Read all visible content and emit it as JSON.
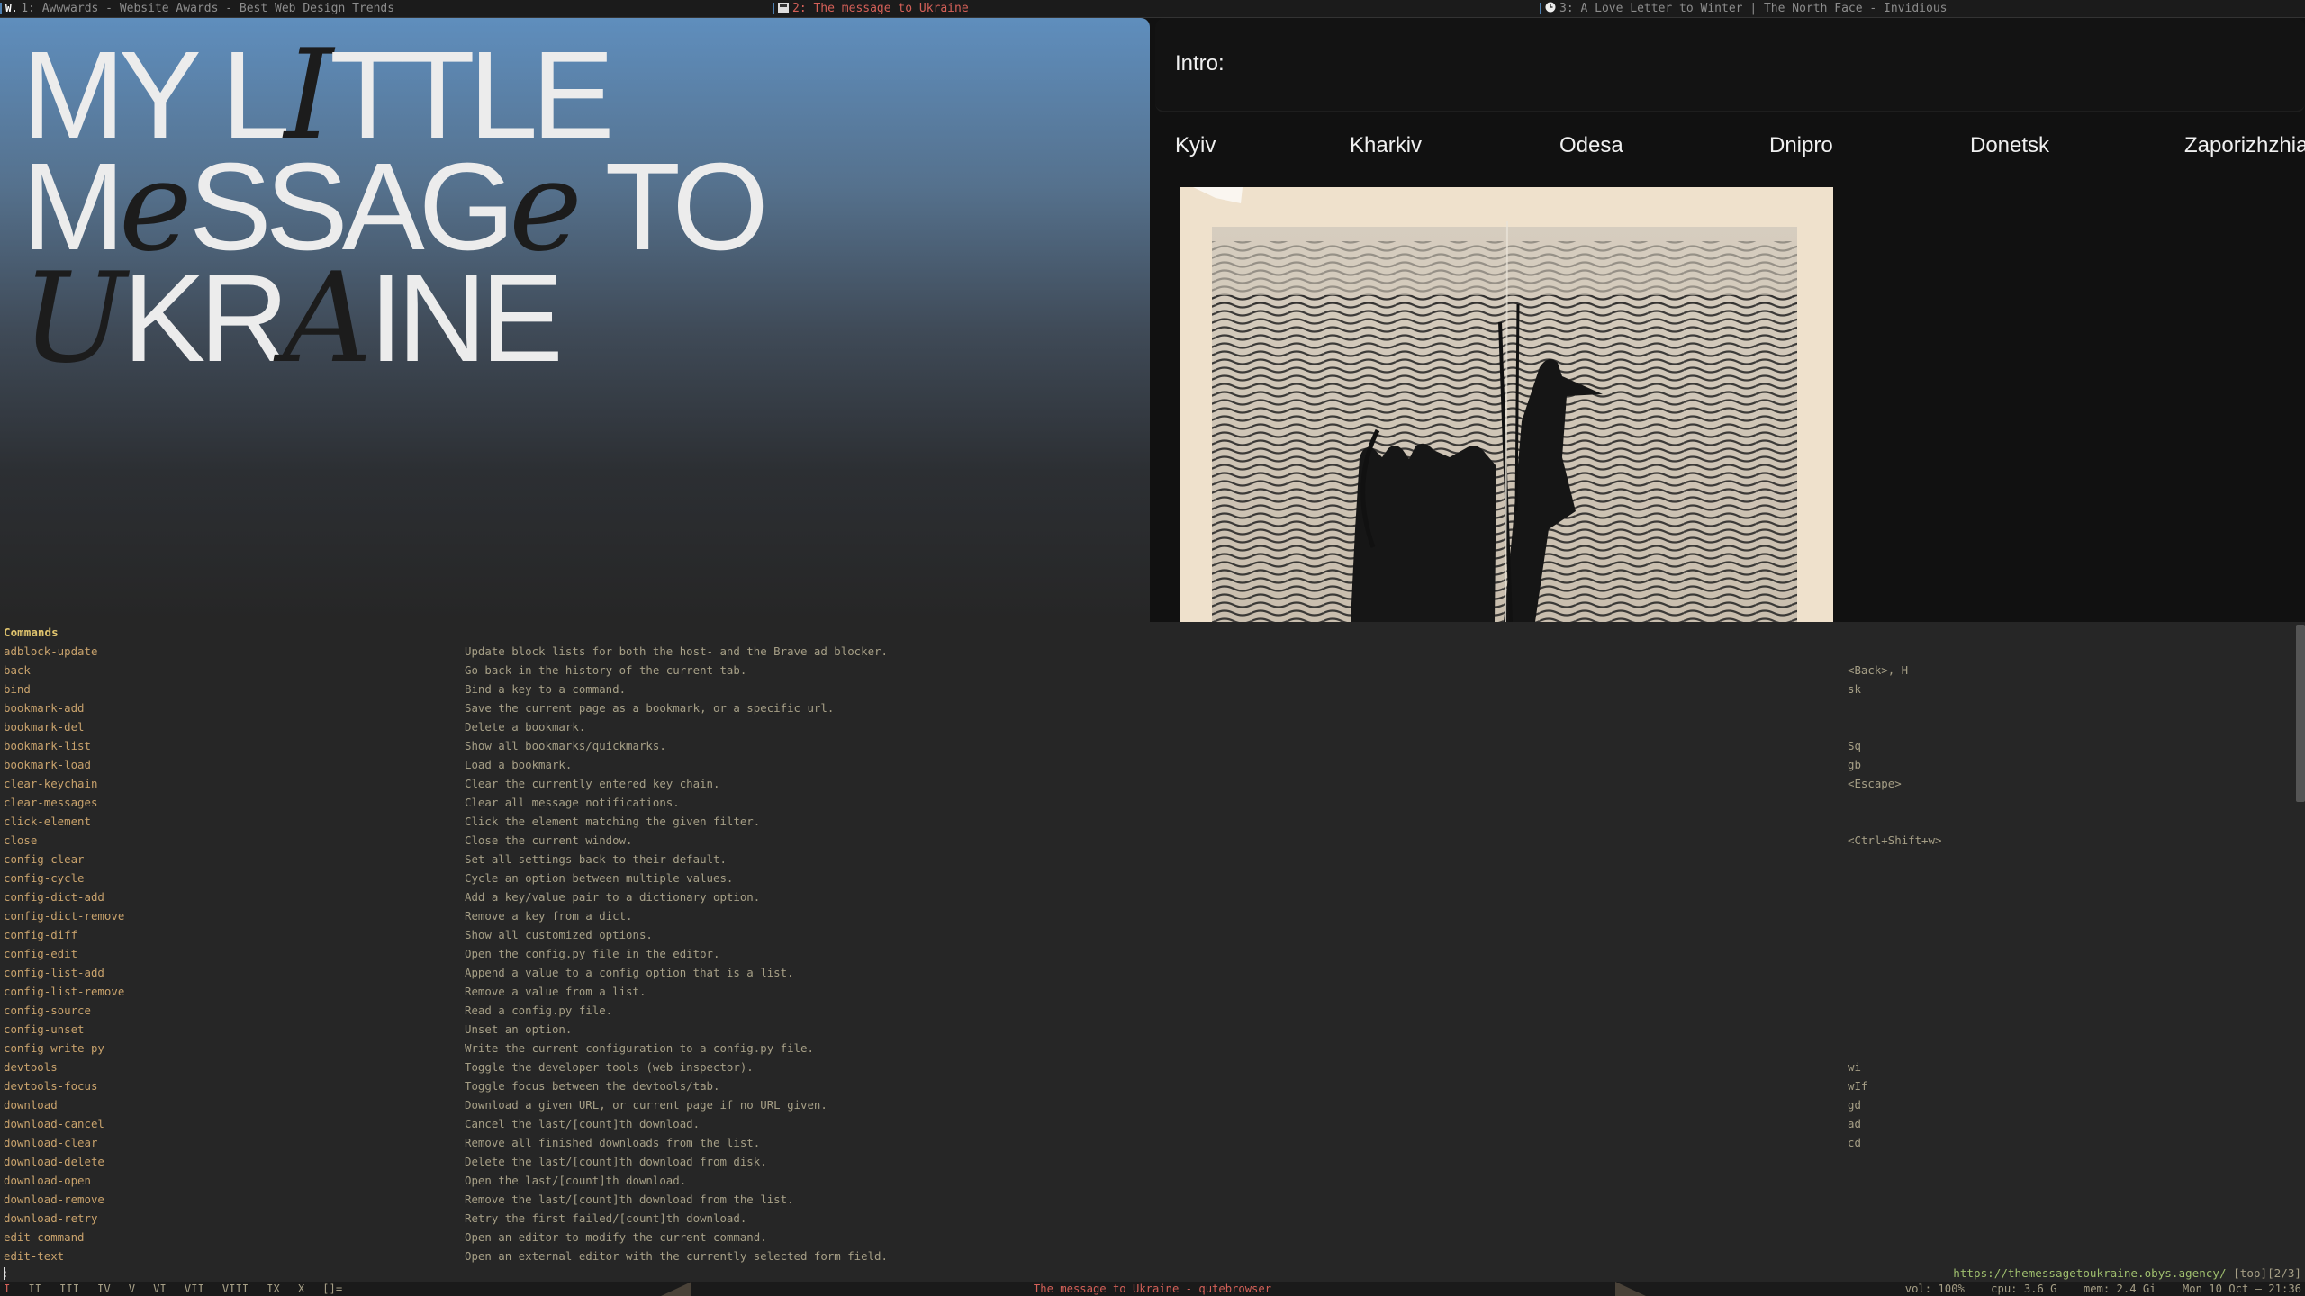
{
  "tabs": [
    {
      "label": "1: Awwwards - Website Awards - Best Web Design Trends",
      "favicon": "W.",
      "active": false
    },
    {
      "label": "2: The message to Ukraine",
      "favicon": "flag-icon",
      "active": true
    },
    {
      "label": "3: A Love Letter to Winter | The North Face - Invidious",
      "favicon": "clock-icon",
      "active": false
    }
  ],
  "hero": {
    "line1_a": "MY L",
    "line1_b": "I",
    "line1_c": "TTLE",
    "line2_a": "M",
    "line2_b": "e",
    "line2_c": "SSAG",
    "line2_d": "e",
    "line2_e": " TO",
    "line3_a": "U",
    "line3_b": "KR",
    "line3_c": "A",
    "line3_d": "INE"
  },
  "intro": {
    "label": "Intro:"
  },
  "cities": [
    "Kyiv",
    "Kharkiv",
    "Odesa",
    "Dnipro",
    "Donetsk",
    "Zaporizhzhia"
  ],
  "completion": {
    "header": "Commands",
    "commands": [
      {
        "name": "adblock-update",
        "desc": "Update block lists for both the host- and the Brave ad blocker.",
        "keys": ""
      },
      {
        "name": "back",
        "desc": "Go back in the history of the current tab.",
        "keys": "<Back>, H"
      },
      {
        "name": "bind",
        "desc": "Bind a key to a command.",
        "keys": "sk"
      },
      {
        "name": "bookmark-add",
        "desc": "Save the current page as a bookmark, or a specific url.",
        "keys": ""
      },
      {
        "name": "bookmark-del",
        "desc": "Delete a bookmark.",
        "keys": ""
      },
      {
        "name": "bookmark-list",
        "desc": "Show all bookmarks/quickmarks.",
        "keys": "Sq"
      },
      {
        "name": "bookmark-load",
        "desc": "Load a bookmark.",
        "keys": "gb"
      },
      {
        "name": "clear-keychain",
        "desc": "Clear the currently entered key chain.",
        "keys": "<Escape>"
      },
      {
        "name": "clear-messages",
        "desc": "Clear all message notifications.",
        "keys": ""
      },
      {
        "name": "click-element",
        "desc": "Click the element matching the given filter.",
        "keys": ""
      },
      {
        "name": "close",
        "desc": "Close the current window.",
        "keys": "<Ctrl+Shift+w>"
      },
      {
        "name": "config-clear",
        "desc": "Set all settings back to their default.",
        "keys": ""
      },
      {
        "name": "config-cycle",
        "desc": "Cycle an option between multiple values.",
        "keys": ""
      },
      {
        "name": "config-dict-add",
        "desc": "Add a key/value pair to a dictionary option.",
        "keys": ""
      },
      {
        "name": "config-dict-remove",
        "desc": "Remove a key from a dict.",
        "keys": ""
      },
      {
        "name": "config-diff",
        "desc": "Show all customized options.",
        "keys": ""
      },
      {
        "name": "config-edit",
        "desc": "Open the config.py file in the editor.",
        "keys": ""
      },
      {
        "name": "config-list-add",
        "desc": "Append a value to a config option that is a list.",
        "keys": ""
      },
      {
        "name": "config-list-remove",
        "desc": "Remove a value from a list.",
        "keys": ""
      },
      {
        "name": "config-source",
        "desc": "Read a config.py file.",
        "keys": ""
      },
      {
        "name": "config-unset",
        "desc": "Unset an option.",
        "keys": ""
      },
      {
        "name": "config-write-py",
        "desc": "Write the current configuration to a config.py file.",
        "keys": ""
      },
      {
        "name": "devtools",
        "desc": "Toggle the developer tools (web inspector).",
        "keys": "wi"
      },
      {
        "name": "devtools-focus",
        "desc": "Toggle focus between the devtools/tab.",
        "keys": "wIf"
      },
      {
        "name": "download",
        "desc": "Download a given URL, or current page if no URL given.",
        "keys": "gd"
      },
      {
        "name": "download-cancel",
        "desc": "Cancel the last/[count]th download.",
        "keys": "ad"
      },
      {
        "name": "download-clear",
        "desc": "Remove all finished downloads from the list.",
        "keys": "cd"
      },
      {
        "name": "download-delete",
        "desc": "Delete the last/[count]th download from disk.",
        "keys": ""
      },
      {
        "name": "download-open",
        "desc": "Open the last/[count]th download.",
        "keys": ""
      },
      {
        "name": "download-remove",
        "desc": "Remove the last/[count]th download from the list.",
        "keys": ""
      },
      {
        "name": "download-retry",
        "desc": "Retry the first failed/[count]th download.",
        "keys": ""
      },
      {
        "name": "edit-command",
        "desc": "Open an editor to modify the current command.",
        "keys": ""
      },
      {
        "name": "edit-text",
        "desc": "Open an external editor with the currently selected form field.",
        "keys": ""
      }
    ]
  },
  "statusbar": {
    "prompt": ":",
    "url": "https://themessagetoukraine.obys.agency/",
    "scroll": "[top]",
    "tab_index": "[2/3]"
  },
  "bottombar": {
    "workspaces": [
      "I",
      "II",
      "III",
      "IV",
      "V",
      "VI",
      "VII",
      "VIII",
      "IX",
      "X",
      "[]="
    ],
    "active_workspace": 0,
    "window_title": "The message to Ukraine - qutebrowser",
    "vol": "vol: 100%",
    "cpu": "cpu: 3.6 G",
    "mem": "mem: 2.4 Gi",
    "datetime": "Mon 10 Oct — 21:36"
  },
  "colors": {
    "accent": "#d46058",
    "completion_bg": "#262626",
    "header": "#e0c46e",
    "url": "#9fbf6e"
  }
}
